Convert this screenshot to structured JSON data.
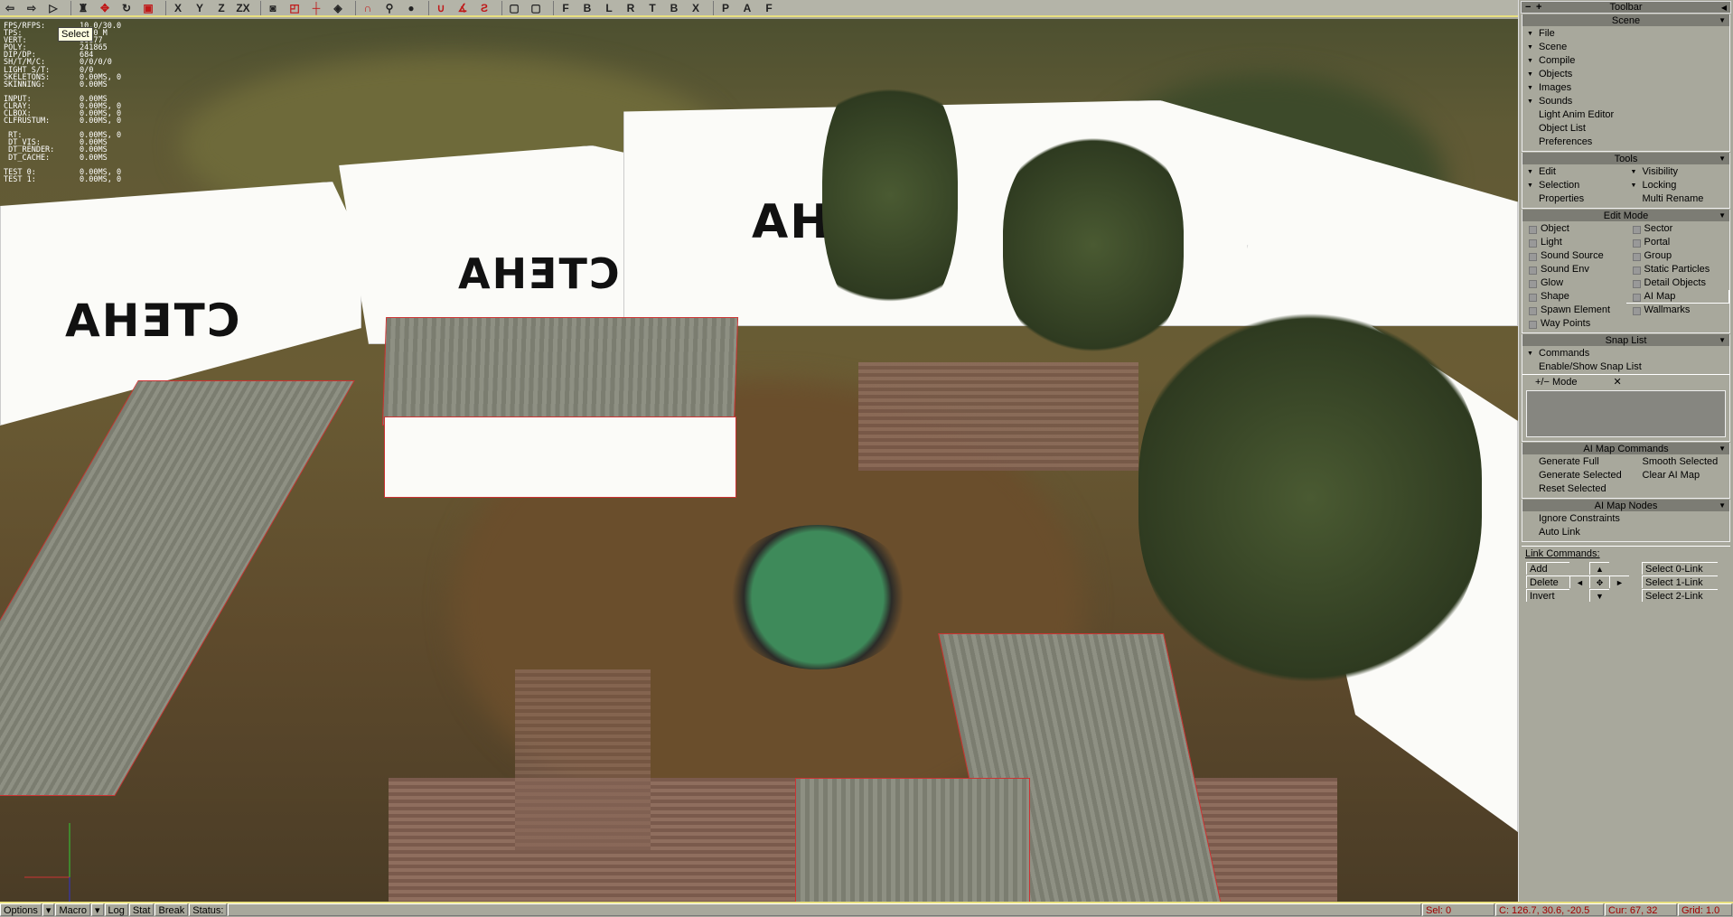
{
  "toolbar": {
    "icons": [
      {
        "name": "undo-icon",
        "glyph": "⇦"
      },
      {
        "name": "redo-icon",
        "glyph": "⇨"
      },
      {
        "name": "select-arrow-icon",
        "glyph": "▷"
      },
      {
        "name": "select-object-icon",
        "glyph": "♜"
      },
      {
        "name": "move-icon",
        "glyph": "✥",
        "red": true
      },
      {
        "name": "rotate-icon",
        "glyph": "↻"
      },
      {
        "name": "scale-icon",
        "glyph": "▣",
        "red": true
      },
      {
        "name": "axis-x-icon",
        "glyph": "X"
      },
      {
        "name": "axis-y-icon",
        "glyph": "Y"
      },
      {
        "name": "axis-z-icon",
        "glyph": "Z"
      },
      {
        "name": "axis-zx-icon",
        "glyph": "ZX"
      },
      {
        "name": "csg-icon",
        "glyph": "◙"
      },
      {
        "name": "snap-box-icon",
        "glyph": "◰",
        "red": true
      },
      {
        "name": "snap-pivot-icon",
        "glyph": "┼",
        "red": true
      },
      {
        "name": "snap-object-icon",
        "glyph": "◈"
      },
      {
        "name": "magnet-icon",
        "glyph": "∩",
        "red": true
      },
      {
        "name": "magnet-object-icon",
        "glyph": "⚲"
      },
      {
        "name": "bomb-icon",
        "glyph": "●"
      },
      {
        "name": "magnet-vertex-icon",
        "glyph": "∪",
        "red": true
      },
      {
        "name": "magnet-angle-icon",
        "glyph": "∡",
        "red": true
      },
      {
        "name": "magnet-2-icon",
        "glyph": "Ƨ",
        "red": true
      },
      {
        "name": "zoom-extent-icon",
        "glyph": "▢"
      },
      {
        "name": "zoom-selected-icon",
        "glyph": "▢"
      },
      {
        "name": "view-front",
        "glyph": "F"
      },
      {
        "name": "view-back",
        "glyph": "B"
      },
      {
        "name": "view-left",
        "glyph": "L"
      },
      {
        "name": "view-right",
        "glyph": "R"
      },
      {
        "name": "view-top",
        "glyph": "T"
      },
      {
        "name": "view-bottom",
        "glyph": "B"
      },
      {
        "name": "view-reset",
        "glyph": "X"
      },
      {
        "name": "perspective-icon",
        "glyph": "P"
      },
      {
        "name": "axonometric-icon",
        "glyph": "A"
      },
      {
        "name": "free-icon",
        "glyph": "F"
      }
    ]
  },
  "tooltip": "Select",
  "wall_text": "СТЕНА",
  "stats": [
    [
      "FPS/RFPS:",
      "10.0/30.0"
    ],
    [
      "TPS:",
      "0.00 M"
    ],
    [
      "VERT:",
      "86677"
    ],
    [
      "POLY:",
      "241865"
    ],
    [
      "DIP/DP:",
      "684"
    ],
    [
      "SH/T/M/C:",
      "0/0/0/0"
    ],
    [
      "LIGHT S/T:",
      "0/0"
    ],
    [
      "SKELETONS:",
      "0.00MS, 0"
    ],
    [
      "SKINNING:",
      "0.00MS"
    ],
    null,
    [
      "INPUT:",
      "0.00MS"
    ],
    [
      "CLRAY:",
      "0.00MS, 0"
    ],
    [
      "CLBOX:",
      "0.00MS, 0"
    ],
    [
      "CLFRUSTUM:",
      "0.00MS, 0"
    ],
    null,
    [
      " RT:",
      "0.00MS, 0"
    ],
    [
      " DT_VIS:",
      "0.00MS"
    ],
    [
      " DT_RENDER:",
      "0.00MS"
    ],
    [
      " DT_CACHE:",
      "0.00MS"
    ],
    null,
    [
      "TEST 0:",
      "0.00MS, 0"
    ],
    [
      "TEST 1:",
      "0.00MS, 0"
    ]
  ],
  "panel": {
    "title": "Toolbar",
    "minus": "−",
    "plus": "+",
    "scene": {
      "title": "Scene",
      "items": [
        {
          "label": "File",
          "tri": true
        },
        {
          "label": "Scene",
          "tri": true
        },
        {
          "label": "Compile",
          "tri": true
        },
        {
          "label": "Objects",
          "tri": true
        },
        {
          "label": "Images",
          "tri": true
        },
        {
          "label": "Sounds",
          "tri": true
        },
        {
          "label": "Light Anim Editor"
        },
        {
          "label": "Object List"
        },
        {
          "label": "Preferences"
        }
      ]
    },
    "tools": {
      "title": "Tools",
      "items": [
        {
          "label": "Edit",
          "tri": true
        },
        {
          "label": "Visibility",
          "tri": true
        },
        {
          "label": "Selection",
          "tri": true
        },
        {
          "label": "Locking",
          "tri": true
        },
        {
          "label": "Properties"
        },
        {
          "label": "Multi Rename"
        }
      ]
    },
    "edit_mode": {
      "title": "Edit Mode",
      "items": [
        "Object",
        "Sector",
        "Light",
        "Portal",
        "Sound Source",
        "Group",
        "Sound Env",
        "Static Particles",
        "Glow",
        "Detail Objects",
        "Shape",
        "AI Map",
        "Spawn Element",
        "Wallmarks",
        "Way Points"
      ],
      "active": "AI Map"
    },
    "snap_list": {
      "title": "Snap List",
      "commands": "Commands",
      "enable": "Enable/Show Snap List",
      "mode": "+/− Mode",
      "clear": "✕"
    },
    "ai_map_commands": {
      "title": "AI Map Commands",
      "items": [
        "Generate Full",
        "Smooth Selected",
        "Generate Selected",
        "Clear AI Map",
        "Reset Selected"
      ]
    },
    "ai_map_nodes": {
      "title": "AI Map Nodes",
      "items": [
        "Ignore Constraints",
        "Auto Link"
      ]
    },
    "link_commands": {
      "title": "Link Commands:",
      "add": "Add",
      "delete": "Delete",
      "invert": "Invert",
      "select0": "Select 0-Link",
      "select1": "Select 1-Link",
      "select2": "Select 2-Link"
    }
  },
  "statusbar": {
    "options": "Options",
    "macro": "Macro",
    "log": "Log",
    "stat": "Stat",
    "break": "Break",
    "status": "Status:",
    "sel": "Sel: 0",
    "coords": "C: 126.7, 30.6, -20.5",
    "cursor": "Cur: 67, 32",
    "grid": "Grid: 1.0"
  }
}
